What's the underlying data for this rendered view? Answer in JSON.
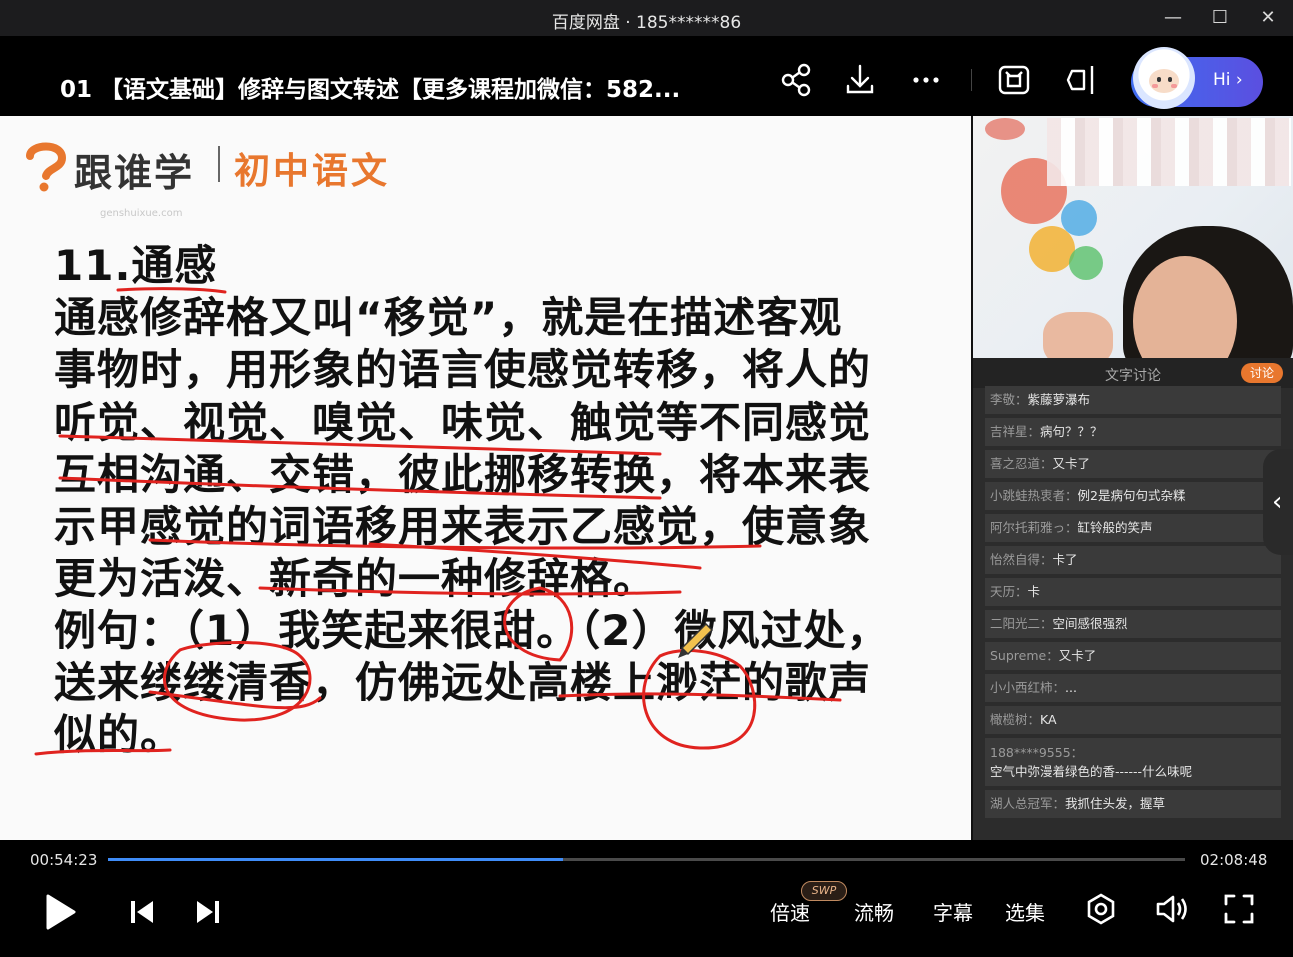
{
  "window": {
    "app_title": "百度网盘 · 185******86",
    "minimize": "—",
    "maximize": "☐",
    "close": "✕"
  },
  "header": {
    "video_title": "01 【语文基础】修辞与图文转述【更多课程加微信：582...",
    "assistant_label": "Hi ›",
    "icons": [
      "share-icon",
      "download-icon",
      "more-icon",
      "screen-cast-icon",
      "picture-in-picture-icon"
    ]
  },
  "slide": {
    "logo_name": "跟谁学",
    "logo_subject": "初中语文",
    "logo_watermark": "genshuixue.com",
    "lines": [
      "11.通感",
      "通感修辞格又叫“移觉”，就是在描述客观",
      "事物时，用形象的语言使感觉转移，将人的",
      "听觉、视觉、嗅觉、味觉、触觉等不同感觉",
      "互相沟通、交错，彼此挪移转换，将本来表",
      "示甲感觉的词语移用来表示乙感觉，使意象",
      "更为活泼、新奇的一种修辞格。",
      "例句：（1）我笑起来很甜。（2）微风过处，",
      "送来缕缕清香，仿佛远处高楼上渺茫的歌声",
      "似的。"
    ]
  },
  "side_panel": {
    "chat_title": "文字讨论",
    "chat_tag": "讨论",
    "messages": [
      {
        "user": "李敬：",
        "text": "紫藤萝瀑布"
      },
      {
        "user": "吉祥星：",
        "text": "病句？？？"
      },
      {
        "user": "喜之忍道：",
        "text": "又卡了"
      },
      {
        "user": "小跳蛙热衷者：",
        "text": "例2是病句句式杂糅"
      },
      {
        "user": "阿尔托莉雅っ：",
        "text": "缸铃般的笑声"
      },
      {
        "user": "怡然自得：",
        "text": "卡了"
      },
      {
        "user": "天历：",
        "text": "卡"
      },
      {
        "user": "二阳光二：",
        "text": "空间感很强烈"
      },
      {
        "user": "Supreme：",
        "text": "又卡了"
      },
      {
        "user": "小小西红柿：",
        "text": "..."
      },
      {
        "user": "橄榄树：",
        "text": "KA"
      },
      {
        "user": "188****9555：",
        "text": "空气中弥漫着绿色的香------什么味呢"
      },
      {
        "user": "湖人总冠军：",
        "text": "我抓住头发，握草"
      }
    ]
  },
  "player": {
    "current_time": "00:54:23",
    "total_time": "02:08:48",
    "progress": 0.4225,
    "speed_label": "倍速",
    "speed_badge": "SWP",
    "quality_label": "流畅",
    "subtitle_label": "字幕",
    "episodes_label": "选集",
    "accent_color": "#3f8cf7"
  }
}
